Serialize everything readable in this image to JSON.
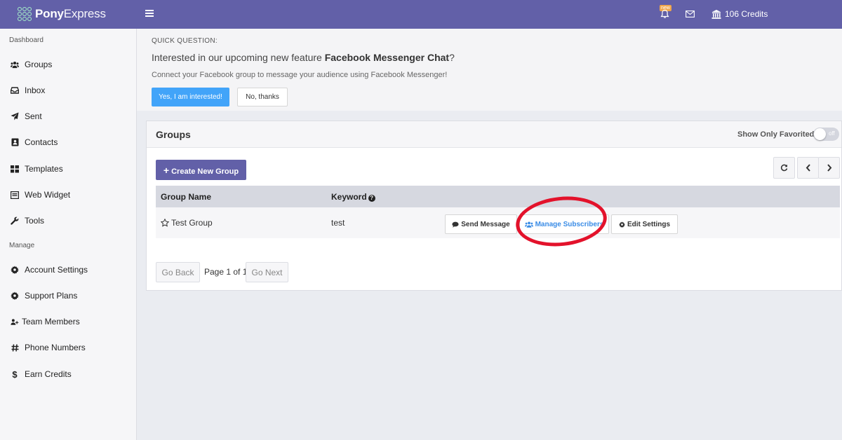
{
  "app": {
    "brand_bold": "Pony",
    "brand_light": "Express",
    "credits": "106 Credits",
    "notification_badge": "new"
  },
  "sidebar": {
    "section_dashboard": "Dashboard",
    "section_manage": "Manage",
    "dashboard_items": [
      {
        "label": "Groups",
        "icon": "users-icon"
      },
      {
        "label": "Inbox",
        "icon": "inbox-icon"
      },
      {
        "label": "Sent",
        "icon": "paper-plane-icon"
      },
      {
        "label": "Contacts",
        "icon": "address-book-icon"
      },
      {
        "label": "Templates",
        "icon": "grid-icon"
      },
      {
        "label": "Web Widget",
        "icon": "widget-icon"
      },
      {
        "label": "Tools",
        "icon": "wrench-icon"
      }
    ],
    "manage_items": [
      {
        "label": "Account Settings",
        "icon": "gear-icon"
      },
      {
        "label": "Support Plans",
        "icon": "gear-icon"
      },
      {
        "label": "Team Members",
        "icon": "user-plus-icon"
      },
      {
        "label": "Phone Numbers",
        "icon": "hash-icon"
      },
      {
        "label": "Earn Credits",
        "icon": "dollar-icon"
      }
    ]
  },
  "banner": {
    "kicker": "QUICK QUESTION:",
    "title_prefix": "Interested in our upcoming new feature ",
    "title_bold": "Facebook Messenger Chat",
    "title_suffix": "?",
    "description": "Connect your Facebook group to message your audience using Facebook Messenger!",
    "yes_label": "Yes, I am interested!",
    "no_label": "No, thanks"
  },
  "groups_panel": {
    "title": "Groups",
    "favorite_label": "Show Only Favorited",
    "toggle_state": "off",
    "create_label": "Create New Group",
    "columns": [
      "Group Name",
      "Keyword"
    ],
    "rows": [
      {
        "name": "Test Group",
        "keyword": "test",
        "send_label": "Send Message",
        "manage_label": "Manage Subscribers",
        "settings_label": "Edit Settings"
      }
    ],
    "pager": {
      "back_label": "Go Back",
      "page_text": "Page 1 of 1",
      "next_label": "Go Next"
    }
  },
  "colors": {
    "topbar": "#6260a8",
    "primary_button": "#42a4f9",
    "highlight": "#e3122b"
  }
}
